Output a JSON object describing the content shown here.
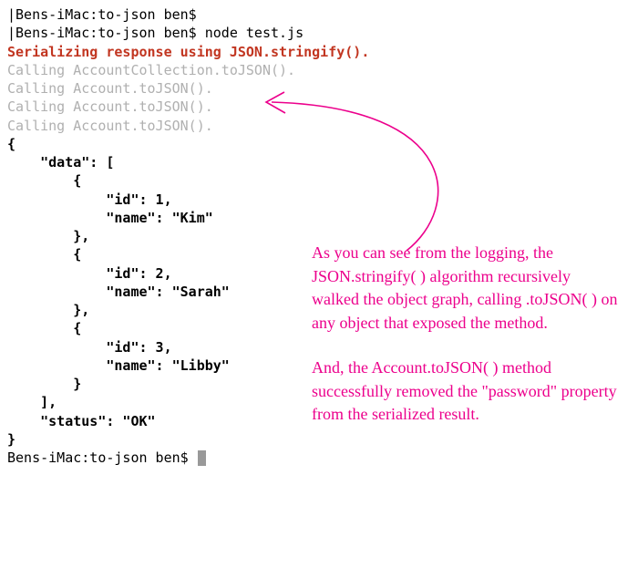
{
  "prompt1": "Bens-iMac:to-json ben$",
  "prompt2": "Bens-iMac:to-json ben$ ",
  "command": "node test.js",
  "log_serializing_prefix": "Serializing response using ",
  "log_serializing_call": "JSON.stringify()",
  "log_serializing_suffix": ".",
  "log_collection": "Calling AccountCollection.toJSON().",
  "log_account_1": "Calling Account.toJSON().",
  "log_account_2": "Calling Account.toJSON().",
  "log_account_3": "Calling Account.toJSON().",
  "json_line_0": "{",
  "json_line_1": "    \"data\": [",
  "json_line_2": "        {",
  "json_line_3": "            \"id\": 1,",
  "json_line_4": "            \"name\": \"Kim\"",
  "json_line_5": "        },",
  "json_line_6": "        {",
  "json_line_7": "            \"id\": 2,",
  "json_line_8": "            \"name\": \"Sarah\"",
  "json_line_9": "        },",
  "json_line_10": "        {",
  "json_line_11": "            \"id\": 3,",
  "json_line_12": "            \"name\": \"Libby\"",
  "json_line_13": "        }",
  "json_line_14": "    ],",
  "json_line_15": "    \"status\": \"OK\"",
  "json_line_16": "}",
  "prompt3": "Bens-iMac:to-json ben$ ",
  "annotation": {
    "p1_pre": "As you can see from the logging, the ",
    "p1_s1": "JSON.stringify( )",
    "p1_mid1": " algorithm ",
    "p1_s2": "recursively walked",
    "p1_mid2": " the object graph, ",
    "p1_s3": "calling .toJSON( )",
    "p1_post": " on any object that exposed the method.",
    "p2_pre": "And, the ",
    "p2_s1": "Account.toJSON( )",
    "p2_mid1": " method ",
    "p2_s2": "successfully removed the \"password\" property",
    "p2_post": " from the serialized result."
  }
}
